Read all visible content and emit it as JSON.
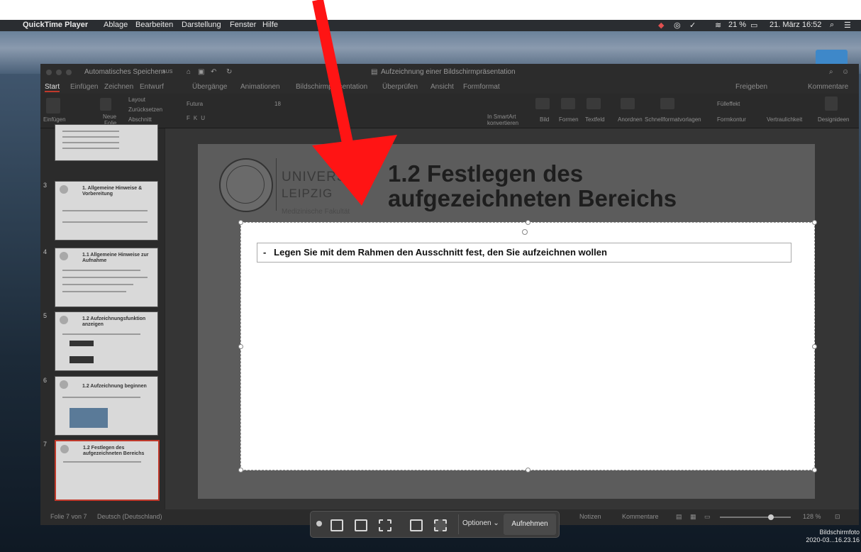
{
  "menubar": {
    "app": "QuickTime Player",
    "items": [
      "Ablage",
      "Bearbeiten",
      "Darstellung",
      "Fenster",
      "Hilfe"
    ],
    "battery": "21 %",
    "datetime": "21. März 16:52"
  },
  "window": {
    "autosave": "Automatisches Speichern",
    "autosave_state": "AUS",
    "title": "Aufzeichnung einer Bildschirmpräsentation",
    "tabs": [
      "Start",
      "Einfügen",
      "Zeichnen",
      "Entwurf",
      "Übergänge",
      "Animationen",
      "Bildschirmpräsentation",
      "Überprüfen",
      "Ansicht",
      "Formformat"
    ],
    "share": "Freigeben",
    "comments": "Kommentare"
  },
  "ribbon": {
    "paste": "Einfügen",
    "new_slide_1": "Neue",
    "new_slide_2": "Folie",
    "layout": "Layout",
    "reset": "Zurücksetzen",
    "section": "Abschnitt",
    "font": "Futura",
    "fontsize": "18",
    "smartart_1": "In SmartArt",
    "smartart_2": "konvertieren",
    "image": "Bild",
    "shapes": "Formen",
    "textbox": "Textfeld",
    "arrange": "Anordnen",
    "quickstyles": "Schnellformatvorlagen",
    "fill": "Fülleffekt",
    "outline": "Formkontur",
    "sensitivity": "Vertraulichkeit",
    "designer": "Designideen"
  },
  "thumbnails": [
    {
      "num": "3",
      "title": "1.  Allgemeine Hinweise & Vorbereitung"
    },
    {
      "num": "4",
      "title": "1.1 Allgemeine Hinweise zur Aufnahme"
    },
    {
      "num": "5",
      "title": "1.2 Aufzeichnungsfunktion anzeigen"
    },
    {
      "num": "6",
      "title": "1.2 Aufzeichnung beginnen"
    },
    {
      "num": "7",
      "title": "1.2 Festlegen des aufgezeichneten Bereichs"
    }
  ],
  "slide": {
    "uni_line1": "UNIVERSITÄT",
    "uni_line2": "LEIPZIG",
    "faculty": "Medizinische Fakultät",
    "title_line1": "1.2 Festlegen des",
    "title_line2": "aufgezeichneten Bereichs",
    "bullet": "Legen Sie mit dem Rahmen den Ausschnitt fest, den Sie aufzeichnen wollen"
  },
  "statusbar": {
    "slide": "Folie 7 von 7",
    "language": "Deutsch (Deutschland)",
    "notes": "Notizen",
    "comments": "Kommentare",
    "zoom": "128 %"
  },
  "recording": {
    "options": "Optionen",
    "record": "Aufnehmen"
  },
  "screenshot_label": {
    "line1": "Bildschirmfoto",
    "line2": "2020-03...16.23.16"
  },
  "colors": {
    "arrow": "#ff1414",
    "accent": "#c0392b"
  }
}
